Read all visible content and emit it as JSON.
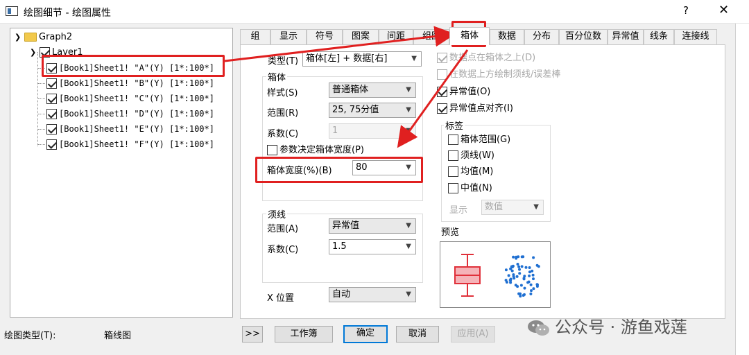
{
  "window": {
    "title": "绘图细节 - 绘图属性",
    "help": "?",
    "close": "✕"
  },
  "tree": {
    "root": "Graph2",
    "layer": "Layer1",
    "plots": [
      "[Book1]Sheet1! \"A\"(Y) [1*:100*]",
      "[Book1]Sheet1! \"B\"(Y) [1*:100*]",
      "[Book1]Sheet1! \"C\"(Y) [1*:100*]",
      "[Book1]Sheet1! \"D\"(Y) [1*:100*]",
      "[Book1]Sheet1! \"E\"(Y) [1*:100*]",
      "[Book1]Sheet1! \"F\"(Y) [1*:100*]"
    ]
  },
  "tabs": [
    "组",
    "显示",
    "符号",
    "图案",
    "间距",
    "组图",
    "箱体",
    "数据",
    "分布",
    "百分位数",
    "异常值",
    "线条",
    "连接线"
  ],
  "active_tab": "箱体",
  "box": {
    "type_label": "类型(T)",
    "type_value": "箱体[左] + 数据[右]",
    "group_title": "箱体",
    "style_label": "样式(S)",
    "style_value": "普通箱体",
    "range_label": "范围(R)",
    "range_value": "25, 75分值",
    "coef_label": "系数(C)",
    "coef_value": "1",
    "param_width_label": "参数决定箱体宽度(P)",
    "width_label": "箱体宽度(%)(B)",
    "width_value": "80"
  },
  "whisker": {
    "group_title": "须线",
    "range_label": "范围(A)",
    "range_value": "异常值",
    "coef_label": "系数(C)",
    "coef_value": "1.5"
  },
  "xpos": {
    "label": "X 位置",
    "value": "自动"
  },
  "options": {
    "points_above": "数据点在箱体之上(D)",
    "draw_whisker_above": "在数据上方绘制须线/误差棒",
    "outliers": "异常值(O)",
    "outlier_align": "异常值点对齐(I)"
  },
  "labels_group": {
    "title": "标签",
    "box_range": "箱体范围(G)",
    "whisker": "须线(W)",
    "mean": "均值(M)",
    "median": "中值(N)",
    "show_label": "显示",
    "show_value": "数值"
  },
  "preview_label": "预览",
  "footer": {
    "plot_type_label": "绘图类型(T):",
    "plot_type_value": "箱线图",
    "expand": ">>",
    "workbook": "工作簿",
    "ok": "确定",
    "cancel": "取消",
    "apply": "应用(A)"
  },
  "watermark": "公众号 · 游鱼戏莲",
  "colors": {
    "annotation_red": "#e02020",
    "box_fill": "#f5b3b8",
    "box_stroke": "#e0303a",
    "points": "#1f6fd1"
  }
}
